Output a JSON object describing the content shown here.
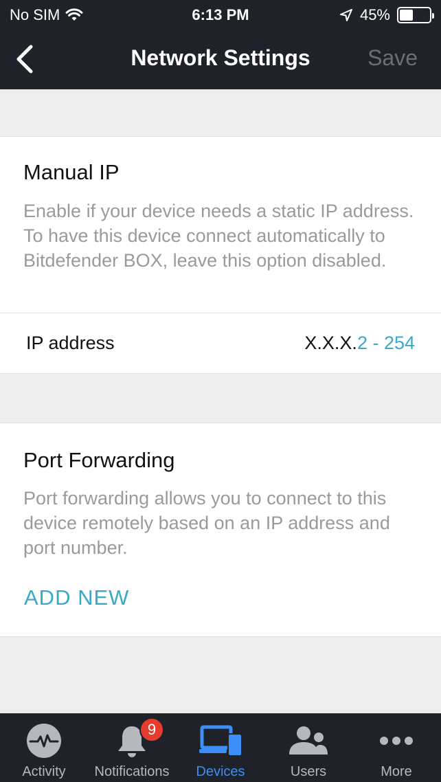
{
  "status_bar": {
    "carrier": "No SIM",
    "time": "6:13 PM",
    "battery": "45%",
    "battery_level": 0.45
  },
  "nav": {
    "title": "Network Settings",
    "save_label": "Save"
  },
  "manual_ip": {
    "title": "Manual IP",
    "description": "Enable if your device needs a static IP address. To have this device connect automatically to Bitdefender BOX, leave this option disabled."
  },
  "ip_address": {
    "label": "IP address",
    "prefix": "X.X.X.",
    "range": "2 - 254"
  },
  "port_forwarding": {
    "title": "Port Forwarding",
    "description": "Port forwarding allows you to connect to this device remotely based on an IP address and port number.",
    "add_new_label": "ADD NEW"
  },
  "tabs": [
    {
      "label": "Activity",
      "icon": "activity-icon"
    },
    {
      "label": "Notifications",
      "icon": "bell-icon",
      "badge": "9"
    },
    {
      "label": "Devices",
      "icon": "devices-icon",
      "active": true
    },
    {
      "label": "Users",
      "icon": "users-icon"
    },
    {
      "label": "More",
      "icon": "more-icon"
    }
  ],
  "colors": {
    "accent": "#3aa9c6",
    "tab_active": "#3b8ff6",
    "badge": "#e63c30",
    "header_bg": "#1f2329"
  }
}
